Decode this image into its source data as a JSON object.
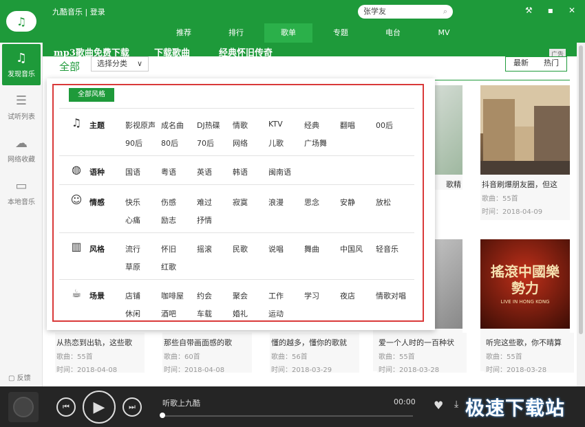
{
  "app": {
    "brand": "九酷音乐",
    "login": "登录",
    "brand_sep": "|"
  },
  "search": {
    "value": "张学友"
  },
  "nav_tabs": [
    "推荐",
    "排行",
    "歌单",
    "专题",
    "电台",
    "MV"
  ],
  "nav_active": "歌单",
  "sidebar": {
    "items": [
      {
        "label": "发现音乐",
        "icon": "music-note-icon"
      },
      {
        "label": "试听列表",
        "icon": "list-icon"
      },
      {
        "label": "网络收藏",
        "icon": "cloud-icon"
      },
      {
        "label": "本地音乐",
        "icon": "monitor-icon"
      }
    ],
    "feedback": "反馈"
  },
  "banner": {
    "links": [
      "mp3歌曲免费下载",
      "下载歌曲",
      "经典怀旧传奇"
    ],
    "ad": "广告"
  },
  "filter": {
    "all_label": "全部",
    "select_label": "选择分类",
    "sort": [
      "最新",
      "热门"
    ]
  },
  "dropdown": {
    "all_styles": "全部风格",
    "categories": [
      {
        "name": "主题",
        "icon": "music-note-icon",
        "tags": [
          "影视原声",
          "成名曲",
          "DJ热碟",
          "情歌",
          "KTV",
          "经典",
          "翻唱",
          "00后",
          "90后",
          "80后",
          "70后",
          "网络",
          "儿歌",
          "广场舞"
        ]
      },
      {
        "name": "语种",
        "icon": "globe-icon",
        "tags": [
          "国语",
          "粤语",
          "英语",
          "韩语",
          "闽南语"
        ]
      },
      {
        "name": "情感",
        "icon": "smiley-icon",
        "tags": [
          "快乐",
          "伤感",
          "难过",
          "寂寞",
          "浪漫",
          "思念",
          "安静",
          "放松",
          "心痛",
          "励志",
          "抒情"
        ]
      },
      {
        "name": "风格",
        "icon": "piano-icon",
        "tags": [
          "流行",
          "怀旧",
          "摇滚",
          "民歌",
          "说唱",
          "舞曲",
          "中国风",
          "轻音乐",
          "草原",
          "红歌"
        ]
      },
      {
        "name": "场景",
        "icon": "coffee-cup-icon",
        "tags": [
          "店铺",
          "咖啡屋",
          "约会",
          "聚会",
          "工作",
          "学习",
          "夜店",
          "情歌对唱",
          "休闲",
          "酒吧",
          "车载",
          "婚礼",
          "运动"
        ]
      }
    ]
  },
  "cards_top": [
    {
      "title": "歌精",
      "count": "",
      "date": ""
    },
    {
      "title": "抖音刷爆朋友圈，但这",
      "count": "歌曲：55首",
      "date": "时间：2018-04-09"
    }
  ],
  "cards_bottom": [
    {
      "title": "从热恋到出轨，这些歌",
      "count": "歌曲：55首",
      "date": "时间：2018-04-08"
    },
    {
      "title": "那些自带画面感的歌",
      "count": "歌曲：60首",
      "date": "时间：2018-04-08"
    },
    {
      "title": "懂的越多，懂你的歌就",
      "count": "歌曲：56首",
      "date": "时间：2018-03-29"
    },
    {
      "title": "爱一个人时的一百种状",
      "count": "歌曲：55首",
      "date": "时间：2018-03-28"
    },
    {
      "title": "听完这些歌，你不晴算",
      "count": "歌曲：55首",
      "date": "时间：2018-03-28"
    }
  ],
  "poster_text": {
    "main": "搖滾中國樂勢力",
    "sub": "LIVE IN HONG KONG"
  },
  "player": {
    "song": "听歌上九酷",
    "time": "00:00",
    "progress": 0
  },
  "watermark": "极速下载站",
  "colors": {
    "brand_green": "#1e9a3a",
    "highlight_red": "#d93838",
    "player_bg": "#252525"
  }
}
